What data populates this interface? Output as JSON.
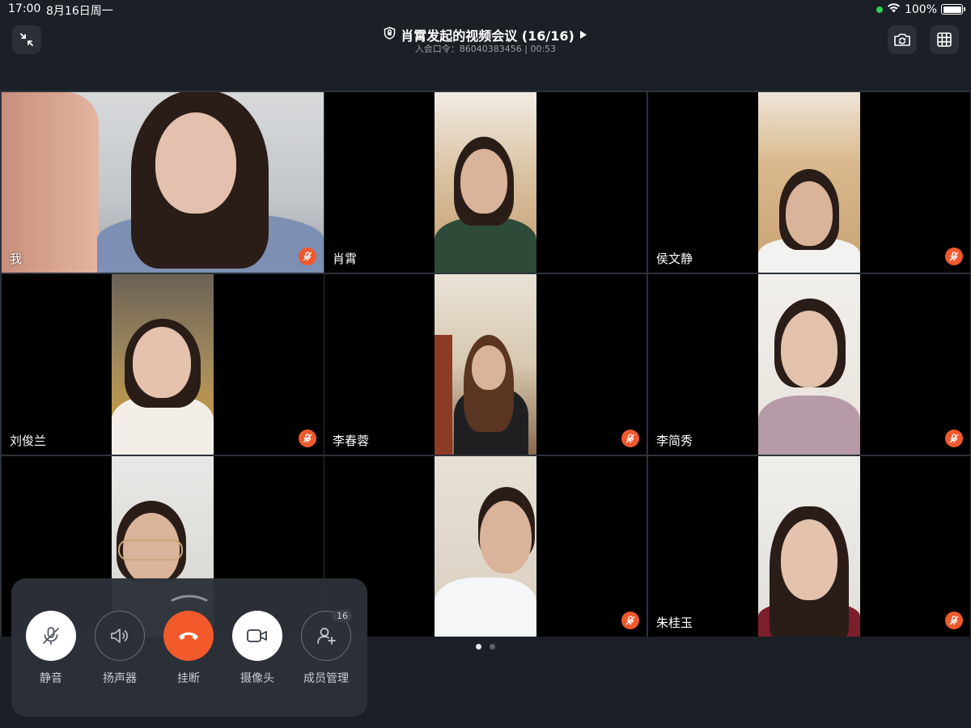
{
  "status_bar": {
    "time": "17:00",
    "date": "8月16日周一",
    "battery": "100%"
  },
  "header": {
    "title": "肖霄发起的视频会议 (16/16)",
    "subtitle": "入会口令：86040383456 | 00:53"
  },
  "participants": [
    {
      "name": "我",
      "muted": true
    },
    {
      "name": "肖霄",
      "muted": false
    },
    {
      "name": "侯文静",
      "muted": true
    },
    {
      "name": "刘俊兰",
      "muted": true
    },
    {
      "name": "李春蓉",
      "muted": true
    },
    {
      "name": "李简秀",
      "muted": true
    },
    {
      "name": "",
      "muted": false
    },
    {
      "name": "",
      "muted": true
    },
    {
      "name": "朱桂玉",
      "muted": true
    }
  ],
  "pagination": {
    "total": 2,
    "current": 1
  },
  "controls": {
    "mute_label": "静音",
    "speaker_label": "扬声器",
    "hangup_label": "挂断",
    "camera_label": "摄像头",
    "members_label": "成员管理",
    "members_count": "16"
  },
  "colors": {
    "accent": "#f25a2c",
    "background": "#1b1f26"
  }
}
